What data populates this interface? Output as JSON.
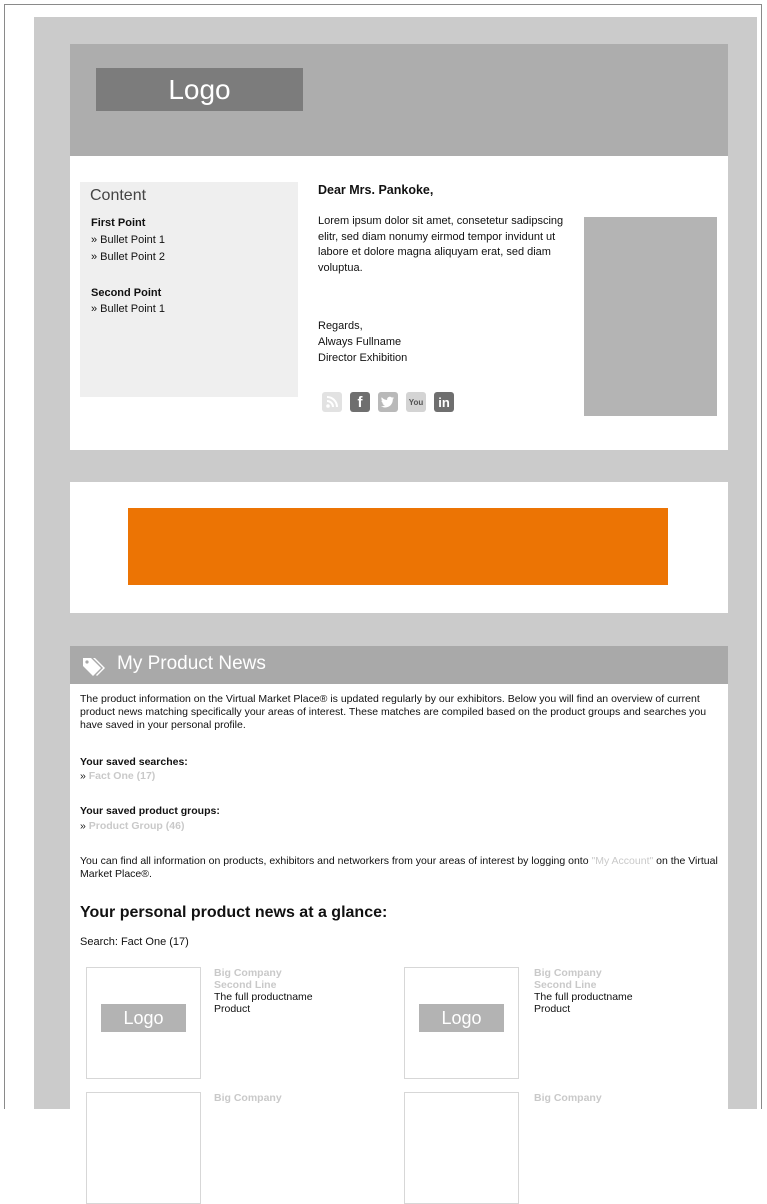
{
  "header": {
    "logo_label": "Logo"
  },
  "sidebar": {
    "title": "Content",
    "sections": [
      {
        "heading": "First Point",
        "items": [
          "» Bullet Point 1",
          "» Bullet Point 2"
        ]
      },
      {
        "heading": "Second Point",
        "items": [
          "» Bullet Point 1"
        ]
      }
    ]
  },
  "letter": {
    "salutation": "Dear Mrs. Pankoke,",
    "body": "Lorem ipsum dolor sit amet, consetetur sadipscing elitr, sed diam nonumy eirmod tempor invidunt ut labore et dolore magna aliquyam erat, sed diam voluptua.",
    "closing": "Regards,",
    "signature_name": "Always Fullname",
    "signature_title": "Director Exhibition"
  },
  "social_icons": [
    "rss-icon",
    "facebook-icon",
    "twitter-icon",
    "youtube-icon",
    "linkedin-icon"
  ],
  "social_glyphs": {
    "facebook": "f",
    "twitter": "t",
    "youtube": "You",
    "linkedin": "in"
  },
  "banner": {
    "color": "#ec7404"
  },
  "news": {
    "title": "My Product News",
    "intro": "The product information on the Virtual Market Place® is updated regularly by our exhibitors. Below you will find an overview of current product news matching specifically your areas of interest. These matches are compiled based on the product groups and searches you have saved in your personal profile.",
    "saved_searches_label": "Your saved searches:",
    "saved_search_item": "Fact One (17)",
    "saved_groups_label": "Your saved product groups:",
    "saved_group_item": "Product Group (46)",
    "arrow": "»",
    "info_before": "You can find all information on products, exhibitors and networkers from your areas of interest by logging onto ",
    "info_link": "\"My Account\"",
    "info_after": " on the Virtual Market Place®.",
    "glance_heading": "Your personal product news at a glance:",
    "search_label": "Search: Fact One (17)"
  },
  "products": [
    {
      "logo": "Logo",
      "company": "Big Company",
      "line2": "Second Line",
      "name": "The full productname",
      "type": "Product"
    },
    {
      "logo": "Logo",
      "company": "Big Company",
      "line2": "Second Line",
      "name": "The full productname",
      "type": "Product"
    }
  ],
  "products_next_row": [
    {
      "company": "Big Company"
    },
    {
      "company": "Big Company"
    }
  ]
}
